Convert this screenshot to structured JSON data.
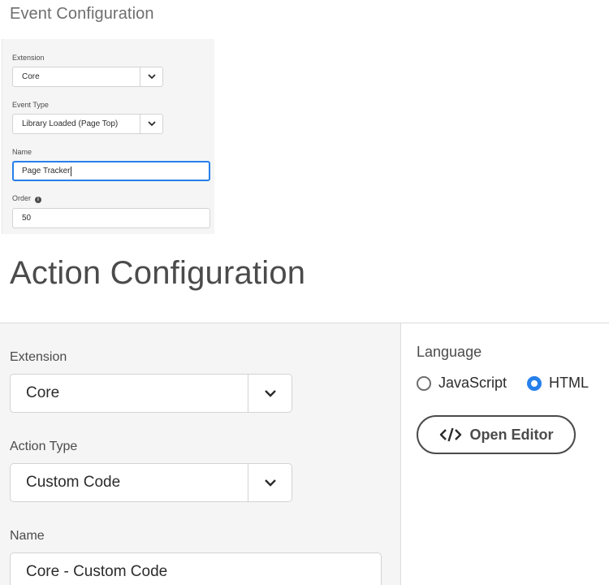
{
  "event_config": {
    "title": "Event Configuration",
    "extension_label": "Extension",
    "extension_value": "Core",
    "event_type_label": "Event Type",
    "event_type_value": "Library Loaded (Page Top)",
    "name_label": "Name",
    "name_value": "Page Tracker",
    "order_label": "Order",
    "order_value": "50"
  },
  "action_config": {
    "title": "Action Configuration",
    "extension_label": "Extension",
    "extension_value": "Core",
    "action_type_label": "Action Type",
    "action_type_value": "Custom Code",
    "name_label": "Name",
    "name_value": "Core - Custom Code",
    "language_label": "Language",
    "languages": [
      {
        "label": "JavaScript",
        "selected": false
      },
      {
        "label": "HTML",
        "selected": true
      }
    ],
    "open_editor_label": "Open Editor"
  },
  "icons": {
    "dropdown": "chevron-down-icon",
    "info": "info-icon",
    "code": "code-icon"
  },
  "colors": {
    "accent": "#2680eb",
    "panel_bg": "#f5f5f5",
    "text": "#2c2c2c"
  }
}
